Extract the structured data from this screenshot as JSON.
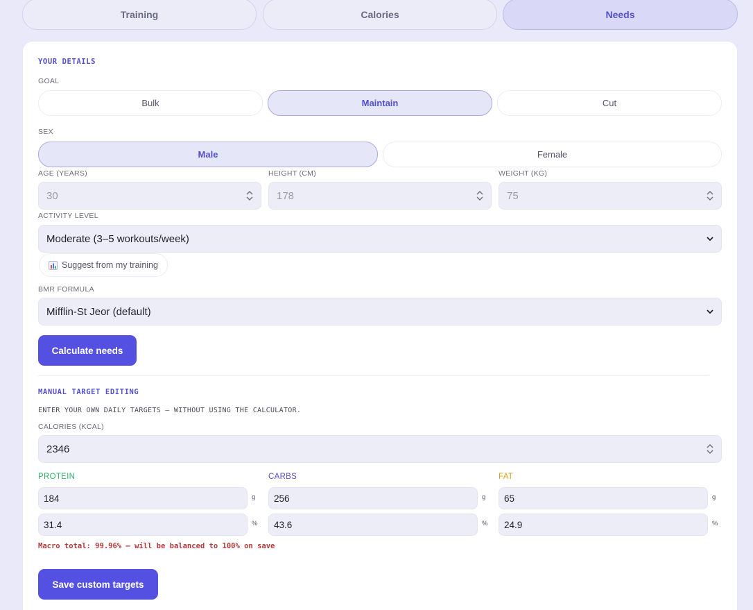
{
  "tabs": [
    "Training",
    "Calories",
    "Needs"
  ],
  "details": {
    "title": "YOUR DETAILS",
    "goal_label": "GOAL",
    "goals": [
      "Bulk",
      "Maintain",
      "Cut"
    ],
    "sex_label": "SEX",
    "sexes": [
      "Male",
      "Female"
    ],
    "age_label": "AGE (YEARS)",
    "age_value": "30",
    "height_label": "HEIGHT (CM)",
    "height_value": "178",
    "weight_label": "WEIGHT (KG)",
    "weight_value": "75",
    "activity_label": "ACTIVITY LEVEL",
    "activity_value": "Moderate (3–5 workouts/week)",
    "suggest_label": "Suggest from my training",
    "bmr_label": "BMR FORMULA",
    "bmr_value": "Mifflin-St Jeor (default)",
    "calculate_label": "Calculate needs"
  },
  "manual": {
    "title": "MANUAL TARGET EDITING",
    "subtitle": "ENTER YOUR OWN DAILY TARGETS — WITHOUT USING THE CALCULATOR.",
    "calories_label": "CALORIES (KCAL)",
    "calories_value": "2346",
    "protein_label": "PROTEIN",
    "protein_g": "184",
    "protein_pct": "31.4",
    "carbs_label": "CARBS",
    "carbs_g": "256",
    "carbs_pct": "43.6",
    "fat_label": "FAT",
    "fat_g": "65",
    "fat_pct": "24.9",
    "unit_g": "g",
    "unit_pct": "%",
    "macro_total_msg": "Macro total: 99.96% — will be balanced to 100% on save",
    "save_label": "Save custom targets"
  },
  "colors": {
    "accent": "#5450e1",
    "protein": "#2fb36a",
    "carbs": "#5450c9",
    "fat": "#d9a21c",
    "warning": "#b23a3a"
  },
  "icons": {
    "suggest": "bar-chart-icon",
    "spinner": "up-down-spinner-icon",
    "select": "chevron-down-icon"
  }
}
